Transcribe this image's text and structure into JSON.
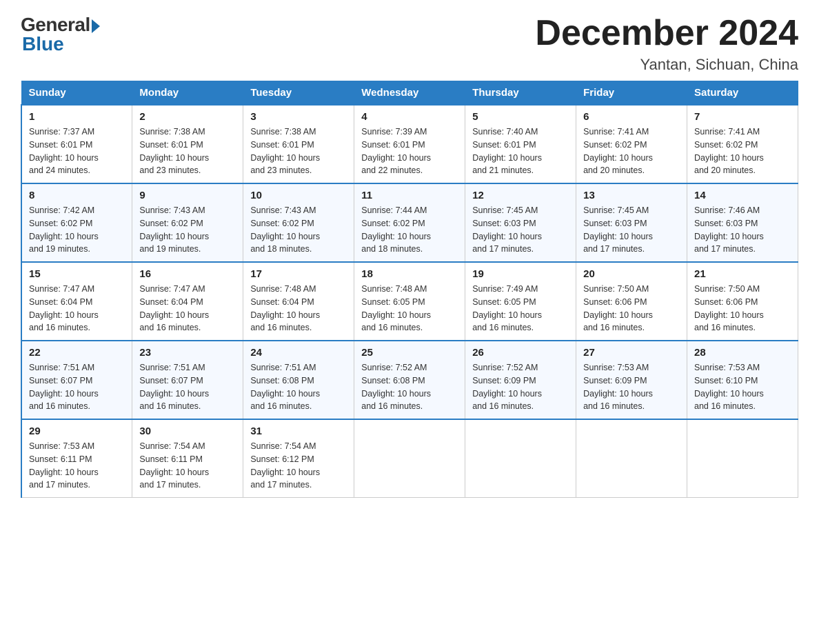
{
  "logo": {
    "general_text": "General",
    "blue_text": "Blue"
  },
  "header": {
    "month_title": "December 2024",
    "location": "Yantan, Sichuan, China"
  },
  "days_of_week": [
    "Sunday",
    "Monday",
    "Tuesday",
    "Wednesday",
    "Thursday",
    "Friday",
    "Saturday"
  ],
  "weeks": [
    [
      {
        "day": "1",
        "sunrise": "7:37 AM",
        "sunset": "6:01 PM",
        "daylight": "10 hours and 24 minutes."
      },
      {
        "day": "2",
        "sunrise": "7:38 AM",
        "sunset": "6:01 PM",
        "daylight": "10 hours and 23 minutes."
      },
      {
        "day": "3",
        "sunrise": "7:38 AM",
        "sunset": "6:01 PM",
        "daylight": "10 hours and 23 minutes."
      },
      {
        "day": "4",
        "sunrise": "7:39 AM",
        "sunset": "6:01 PM",
        "daylight": "10 hours and 22 minutes."
      },
      {
        "day": "5",
        "sunrise": "7:40 AM",
        "sunset": "6:01 PM",
        "daylight": "10 hours and 21 minutes."
      },
      {
        "day": "6",
        "sunrise": "7:41 AM",
        "sunset": "6:02 PM",
        "daylight": "10 hours and 20 minutes."
      },
      {
        "day": "7",
        "sunrise": "7:41 AM",
        "sunset": "6:02 PM",
        "daylight": "10 hours and 20 minutes."
      }
    ],
    [
      {
        "day": "8",
        "sunrise": "7:42 AM",
        "sunset": "6:02 PM",
        "daylight": "10 hours and 19 minutes."
      },
      {
        "day": "9",
        "sunrise": "7:43 AM",
        "sunset": "6:02 PM",
        "daylight": "10 hours and 19 minutes."
      },
      {
        "day": "10",
        "sunrise": "7:43 AM",
        "sunset": "6:02 PM",
        "daylight": "10 hours and 18 minutes."
      },
      {
        "day": "11",
        "sunrise": "7:44 AM",
        "sunset": "6:02 PM",
        "daylight": "10 hours and 18 minutes."
      },
      {
        "day": "12",
        "sunrise": "7:45 AM",
        "sunset": "6:03 PM",
        "daylight": "10 hours and 17 minutes."
      },
      {
        "day": "13",
        "sunrise": "7:45 AM",
        "sunset": "6:03 PM",
        "daylight": "10 hours and 17 minutes."
      },
      {
        "day": "14",
        "sunrise": "7:46 AM",
        "sunset": "6:03 PM",
        "daylight": "10 hours and 17 minutes."
      }
    ],
    [
      {
        "day": "15",
        "sunrise": "7:47 AM",
        "sunset": "6:04 PM",
        "daylight": "10 hours and 16 minutes."
      },
      {
        "day": "16",
        "sunrise": "7:47 AM",
        "sunset": "6:04 PM",
        "daylight": "10 hours and 16 minutes."
      },
      {
        "day": "17",
        "sunrise": "7:48 AM",
        "sunset": "6:04 PM",
        "daylight": "10 hours and 16 minutes."
      },
      {
        "day": "18",
        "sunrise": "7:48 AM",
        "sunset": "6:05 PM",
        "daylight": "10 hours and 16 minutes."
      },
      {
        "day": "19",
        "sunrise": "7:49 AM",
        "sunset": "6:05 PM",
        "daylight": "10 hours and 16 minutes."
      },
      {
        "day": "20",
        "sunrise": "7:50 AM",
        "sunset": "6:06 PM",
        "daylight": "10 hours and 16 minutes."
      },
      {
        "day": "21",
        "sunrise": "7:50 AM",
        "sunset": "6:06 PM",
        "daylight": "10 hours and 16 minutes."
      }
    ],
    [
      {
        "day": "22",
        "sunrise": "7:51 AM",
        "sunset": "6:07 PM",
        "daylight": "10 hours and 16 minutes."
      },
      {
        "day": "23",
        "sunrise": "7:51 AM",
        "sunset": "6:07 PM",
        "daylight": "10 hours and 16 minutes."
      },
      {
        "day": "24",
        "sunrise": "7:51 AM",
        "sunset": "6:08 PM",
        "daylight": "10 hours and 16 minutes."
      },
      {
        "day": "25",
        "sunrise": "7:52 AM",
        "sunset": "6:08 PM",
        "daylight": "10 hours and 16 minutes."
      },
      {
        "day": "26",
        "sunrise": "7:52 AM",
        "sunset": "6:09 PM",
        "daylight": "10 hours and 16 minutes."
      },
      {
        "day": "27",
        "sunrise": "7:53 AM",
        "sunset": "6:09 PM",
        "daylight": "10 hours and 16 minutes."
      },
      {
        "day": "28",
        "sunrise": "7:53 AM",
        "sunset": "6:10 PM",
        "daylight": "10 hours and 16 minutes."
      }
    ],
    [
      {
        "day": "29",
        "sunrise": "7:53 AM",
        "sunset": "6:11 PM",
        "daylight": "10 hours and 17 minutes."
      },
      {
        "day": "30",
        "sunrise": "7:54 AM",
        "sunset": "6:11 PM",
        "daylight": "10 hours and 17 minutes."
      },
      {
        "day": "31",
        "sunrise": "7:54 AM",
        "sunset": "6:12 PM",
        "daylight": "10 hours and 17 minutes."
      },
      null,
      null,
      null,
      null
    ]
  ],
  "labels": {
    "sunrise_prefix": "Sunrise: ",
    "sunset_prefix": "Sunset: ",
    "daylight_prefix": "Daylight: "
  }
}
